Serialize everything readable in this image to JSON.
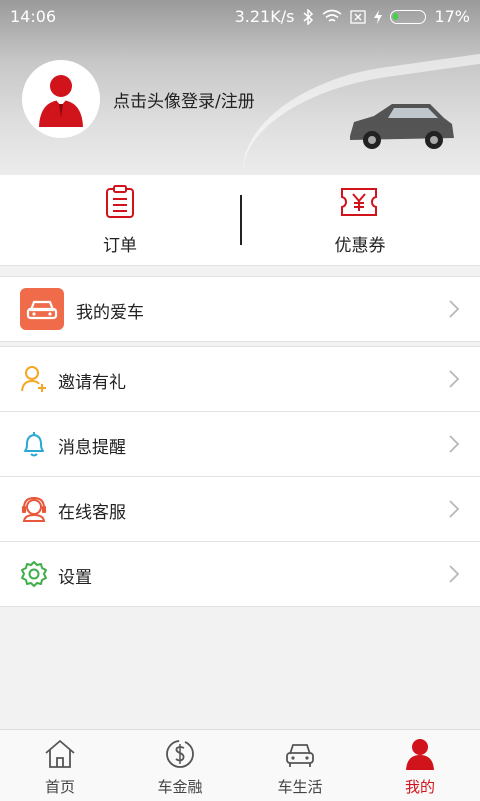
{
  "status_bar": {
    "time": "14:06",
    "network_speed": "3.21K/s",
    "battery_percent": "17%",
    "battery_level": 0.17
  },
  "profile": {
    "login_prompt": "点击头像登录/注册"
  },
  "quick_actions": [
    {
      "label": "订单",
      "icon": "clipboard-icon"
    },
    {
      "label": "优惠券",
      "icon": "coupon-icon"
    }
  ],
  "menu": {
    "my_car": {
      "label": "我的爱车",
      "icon": "car-icon"
    },
    "items": [
      {
        "label": "邀请有礼",
        "icon": "invite-user-icon",
        "color": "#f5a623"
      },
      {
        "label": "消息提醒",
        "icon": "bell-icon",
        "color": "#29a8d6"
      },
      {
        "label": "在线客服",
        "icon": "customer-service-icon",
        "color": "#e8573a"
      },
      {
        "label": "设置",
        "icon": "gear-icon",
        "color": "#3fae49"
      }
    ]
  },
  "tabs": [
    {
      "label": "首页",
      "icon": "home-icon"
    },
    {
      "label": "车金融",
      "icon": "finance-icon"
    },
    {
      "label": "车生活",
      "icon": "car-life-icon"
    },
    {
      "label": "我的",
      "icon": "user-icon",
      "active": true
    }
  ],
  "colors": {
    "brand_red": "#d1141b",
    "my_car_badge": "#f06b4a"
  }
}
